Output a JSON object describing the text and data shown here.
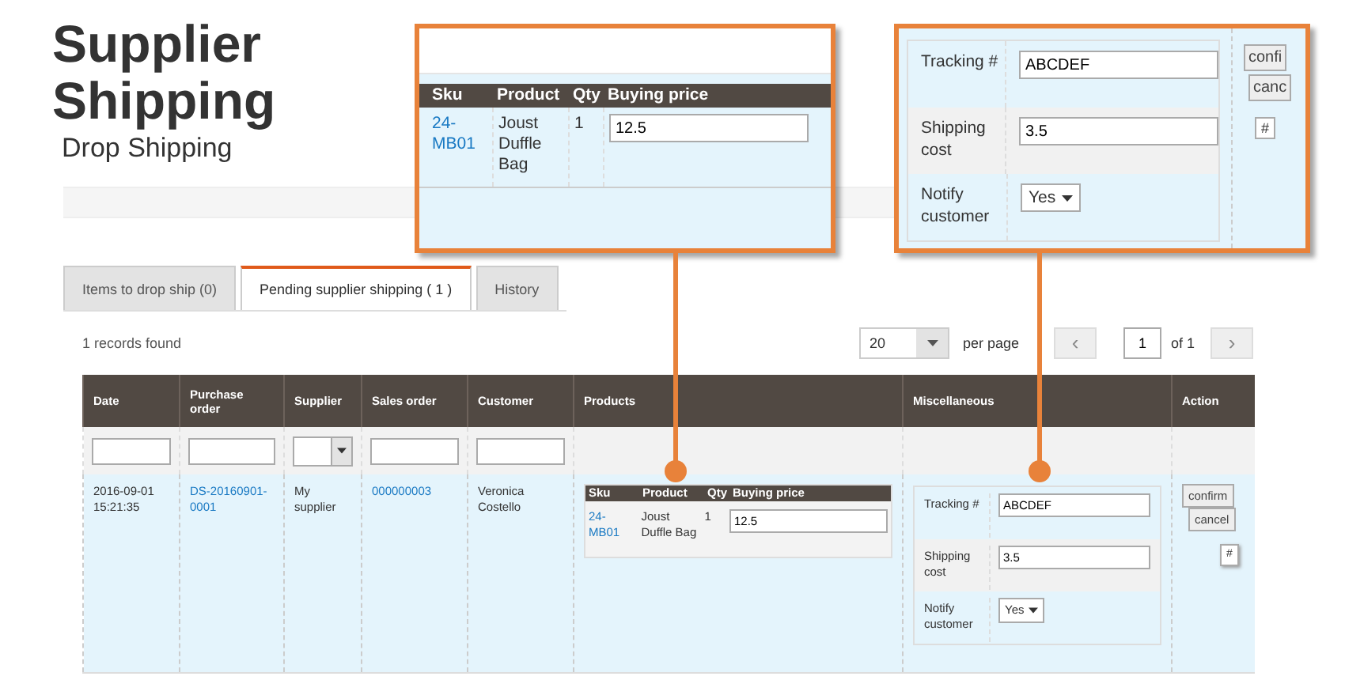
{
  "header": {
    "title": "Supplier Shipping",
    "subtitle": "Drop Shipping"
  },
  "tabs": [
    {
      "label": "Items to drop ship (0)",
      "selected": false
    },
    {
      "label": "Pending supplier shipping ( 1 )",
      "selected": true
    },
    {
      "label": "History",
      "selected": false
    }
  ],
  "records": "1 records found",
  "pager": {
    "page_size": "20",
    "per_page": "per page",
    "prev": "‹",
    "page": "1",
    "of": "of 1",
    "next": "›"
  },
  "table": {
    "columns": [
      {
        "label": "Date",
        "filter": {
          "kind": "text"
        }
      },
      {
        "label": "Purchase order",
        "filter": {
          "kind": "text"
        }
      },
      {
        "label": "Supplier",
        "filter": {
          "kind": "select"
        }
      },
      {
        "label": "Sales order",
        "filter": {
          "kind": "text"
        }
      },
      {
        "label": "Customer",
        "filter": {
          "kind": "text"
        }
      },
      {
        "label": "Products"
      },
      {
        "label": "Miscellaneous"
      },
      {
        "label": "Action"
      }
    ],
    "rows": [
      {
        "date": "2016-09-01 15:21:35",
        "purchase_order": "DS-20160901-0001",
        "supplier": "My supplier",
        "sales_order": "000000003",
        "customer": "Veronica Costello",
        "products": {
          "columns": [
            "Sku",
            "Product",
            "Qty",
            "Buying price"
          ],
          "items": [
            {
              "sku": "24-MB01",
              "product": "Joust Duffle Bag",
              "qty": "1",
              "buying_price": "12.5"
            }
          ]
        },
        "misc": [
          {
            "label": "Tracking #",
            "kind": "text",
            "value": "ABCDEF"
          },
          {
            "label": "Shipping cost",
            "kind": "text",
            "value": "3.5"
          },
          {
            "label": "Notify customer",
            "kind": "select",
            "value": "Yes"
          }
        ],
        "actions": [
          "confirm",
          "cancel"
        ],
        "tooltip": "#"
      }
    ]
  },
  "callouts": [
    {
      "kind": "products",
      "columns": [
        "Sku",
        "Product",
        "Qty",
        "Buying price"
      ],
      "items": [
        {
          "sku": "24-MB01",
          "product": "Joust Duffle Bag",
          "qty": "1",
          "buying_price": "12.5"
        }
      ]
    },
    {
      "kind": "misc",
      "rows": [
        {
          "label": "Tracking #",
          "kind": "text",
          "value": "ABCDEF"
        },
        {
          "label": "Shipping cost",
          "kind": "text",
          "value": "3.5"
        },
        {
          "label": "Notify customer",
          "kind": "select",
          "value": "Yes"
        }
      ],
      "actions": [
        "confi",
        "canc"
      ],
      "tooltip": "#"
    }
  ]
}
